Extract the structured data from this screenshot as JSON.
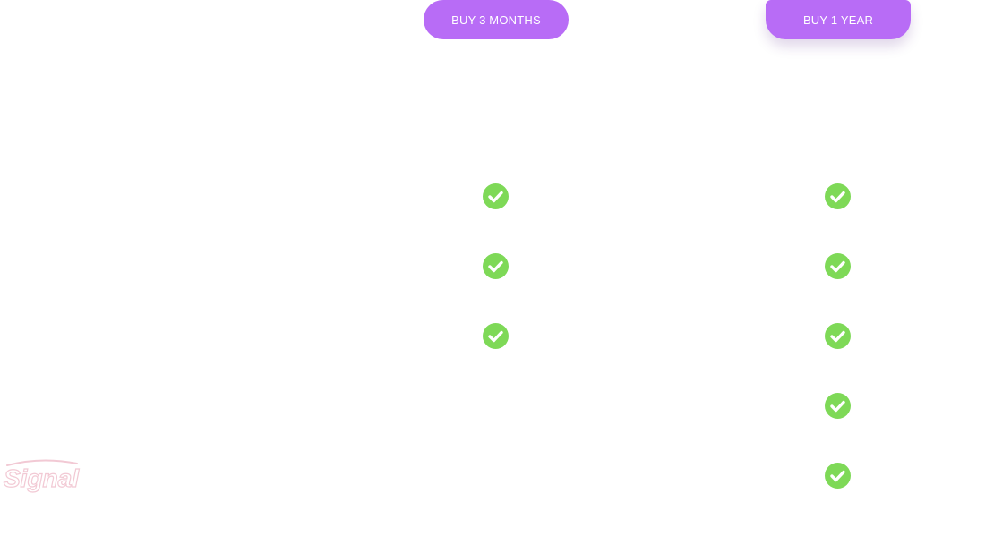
{
  "plans": {
    "three_months": {
      "button_label": "BUY 3 MONTHS",
      "included_features": 3
    },
    "one_year": {
      "button_label": "BUY 1 YEAR",
      "included_features": 5
    }
  },
  "icons": {
    "feature_check": "check-circle-icon"
  },
  "colors": {
    "button_background": "#b86cf6",
    "button_text": "#ffffff",
    "check_fill": "#7ed957",
    "check_mark": "#ffffff",
    "logo_tint": "#f2c9d4"
  },
  "logo": {
    "text": "Signal"
  }
}
